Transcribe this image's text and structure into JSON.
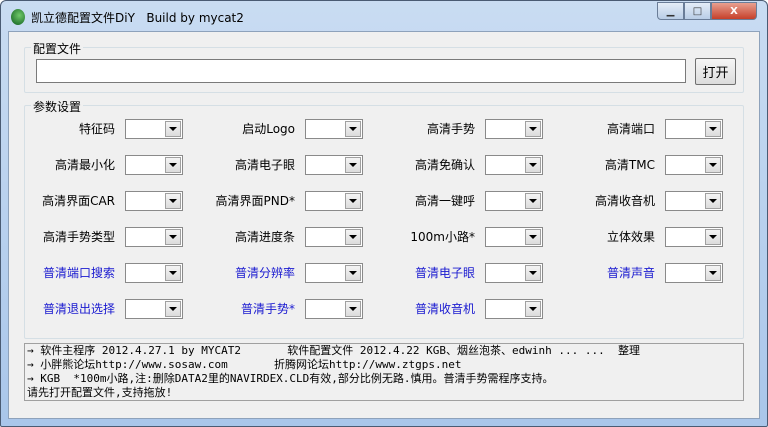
{
  "window": {
    "title": "凯立德配置文件DiY   Build by mycat2"
  },
  "config_group": {
    "label": "配置文件",
    "path_value": "",
    "open_button": "打开"
  },
  "params_group": {
    "label": "参数设置",
    "rows": [
      [
        {
          "label": "特征码",
          "blue": false
        },
        {
          "label": "启动Logo",
          "blue": false
        },
        {
          "label": "高清手势",
          "blue": false
        },
        {
          "label": "高清端口",
          "blue": false
        }
      ],
      [
        {
          "label": "高清最小化",
          "blue": false
        },
        {
          "label": "高清电子眼",
          "blue": false
        },
        {
          "label": "高清免确认",
          "blue": false
        },
        {
          "label": "高清TMC",
          "blue": false
        }
      ],
      [
        {
          "label": "高清界面CAR",
          "blue": false
        },
        {
          "label": "高清界面PND*",
          "blue": false
        },
        {
          "label": "高清一键呼",
          "blue": false
        },
        {
          "label": "高清收音机",
          "blue": false
        }
      ],
      [
        {
          "label": "高清手势类型",
          "blue": false
        },
        {
          "label": "高清进度条",
          "blue": false
        },
        {
          "label": "100m小路*",
          "blue": false
        },
        {
          "label": "立体效果",
          "blue": false
        }
      ],
      [
        {
          "label": "普清端口搜索",
          "blue": true
        },
        {
          "label": "普清分辨率",
          "blue": true
        },
        {
          "label": "普清电子眼",
          "blue": true
        },
        {
          "label": "普清声音",
          "blue": true
        }
      ],
      [
        {
          "label": "普清退出选择",
          "blue": true
        },
        {
          "label": "普清手势*",
          "blue": true
        },
        {
          "label": "普清收音机",
          "blue": true
        }
      ]
    ]
  },
  "log": {
    "lines": [
      "→ 软件主程序 2012.4.27.1 by MYCAT2       软件配置文件 2012.4.22 KGB、烟丝泡茶、edwinh ... ...  整理",
      "→ 小胖熊论坛http://www.sosaw.com       折腾网论坛http://www.ztgps.net",
      "→ KGB  *100m小路,注:删除DATA2里的NAVIRDEX.CLD有效,部分比例无路.慎用。普清手势需程序支持。",
      "请先打开配置文件,支持拖放!"
    ]
  },
  "colors": {
    "blue_label": "#1a1ad0"
  }
}
